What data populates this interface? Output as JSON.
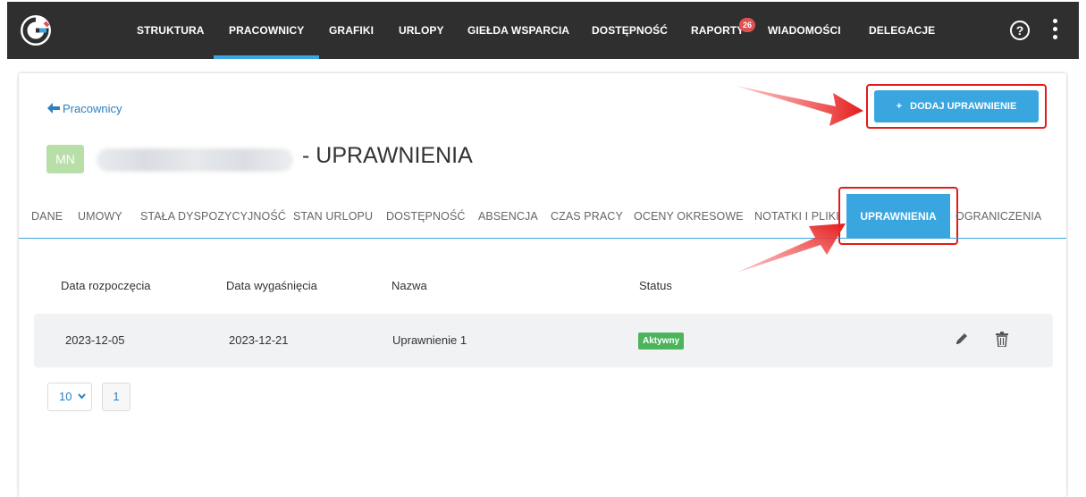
{
  "nav": {
    "items": [
      {
        "label": "STRUKTURA"
      },
      {
        "label": "PRACOWNICY",
        "active": true
      },
      {
        "label": "GRAFIKI"
      },
      {
        "label": "URLOPY"
      },
      {
        "label": "GIEŁDA WSPARCIA"
      },
      {
        "label": "DOSTĘPNOŚĆ"
      },
      {
        "label": "RAPORTY"
      },
      {
        "label": "WIADOMOŚCI"
      },
      {
        "label": "DELEGACJE"
      }
    ],
    "raporty_badge": "26",
    "help_icon": "question-circle-icon",
    "more_icon": "more-vertical-icon",
    "accent": "#3aa6e0",
    "bar_color": "#2f2f2f"
  },
  "page": {
    "back_label": "Pracownicy",
    "add_button_plus": "+",
    "add_button_label": "DODAJ UPRAWNIENIE",
    "avatar_initials": "MN",
    "title_suffix": "- UPRAWNIENIA"
  },
  "tabs": [
    {
      "label": "DANE"
    },
    {
      "label": "UMOWY"
    },
    {
      "label": "STAŁA DYSPOZYCYJNOŚĆ"
    },
    {
      "label": "STAN URLOPU"
    },
    {
      "label": "DOSTĘPNOŚĆ"
    },
    {
      "label": "ABSENCJA"
    },
    {
      "label": "CZAS PRACY"
    },
    {
      "label": "OCENY OKRESOWE"
    },
    {
      "label": "NOTATKI I PLIKI"
    },
    {
      "label": "UPRAWNIENIA",
      "active": true
    },
    {
      "label": "OGRANICZENIA"
    }
  ],
  "table": {
    "columns": [
      "Data rozpoczęcia",
      "Data wygaśnięcia",
      "Nazwa",
      "Status"
    ],
    "rows": [
      {
        "start": "2023-12-05",
        "end": "2023-12-21",
        "name": "Uprawnienie 1",
        "status": "Aktywny"
      }
    ],
    "status_color": "#4cb45b"
  },
  "pagination": {
    "page_size": "10",
    "current_page": "1"
  },
  "annotations": {
    "highlight_color": "#e31b1b"
  }
}
